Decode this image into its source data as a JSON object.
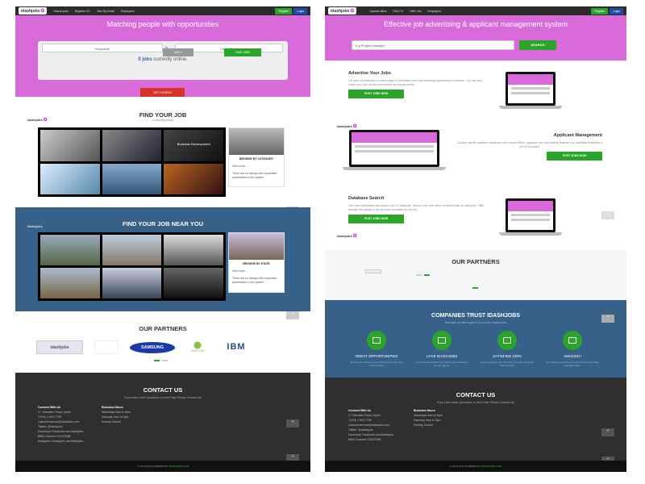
{
  "nav": {
    "logo": "idashjobs",
    "links_left": [
      "Search jobs",
      "Register CV",
      "Jobs By Email",
      "Employers"
    ],
    "links_right": [
      "Special offers",
      "Find CV",
      "Offer Job",
      "Employers"
    ],
    "register": "Register",
    "login": "Login"
  },
  "left": {
    "hero_title": "Matching people with opportunities",
    "keywords_placeholder": "Keywords",
    "in": "in",
    "city_placeholder": "City or State",
    "jobs_count": "0 jobs",
    "jobs_suffix": "currently online.",
    "any_button": "ANY ▾",
    "find_button": "FIND JOBS",
    "hired_button": "GET HIRED!",
    "find_job_title": "FIND YOUR JOB",
    "find_job_sub": "In trending areas",
    "tile_label": "Business Development",
    "browse_category": "BROWSE BY CATEGORY",
    "card_text_1": "View more...",
    "card_text_2": "There are no listings with requested parameters in the system.",
    "near_title": "FIND YOUR JOB NEAR YOU",
    "browse_state": "BROWSE BY STATE",
    "partners_title": "OUR PARTNERS",
    "partners": [
      "idashjobs",
      "Apple",
      "SAMSUNG",
      "ANDROID",
      "IBM"
    ],
    "contact_title": "CONTACT US",
    "contact_sub": "If you have some Questions or need Help! Please Contact Us!",
    "connect_title": "Connect With Us",
    "connect_lines": [
      "17, Salvation Road, Opebi",
      "+(234) 1 849 7759",
      "customerservice@idashjobs.com",
      "Twitter: @idashjobs",
      "Facebook: Facebook.com/idashjobs",
      "BBM Channel: C0047E6B",
      "Instagram: instagram.com/idashjobs"
    ],
    "hours_title": "Business Hours",
    "hours_lines": [
      "Weekdays 9am to 5pm",
      "Saturday 9am to 3pm",
      "Sunday Closed"
    ],
    "copyright": "© 2014-2016 POWERED BY",
    "copyright_brand": "IDASHJOBS.COM"
  },
  "right": {
    "hero_title": "Effective job advertising & applicant management system",
    "search_placeholder": "e.g Project manager",
    "search_button": "SEARCH",
    "advertise_title": "Advertise Your Jobs",
    "advertise_text": "Get your job adverts to a wide range of candidates and start receiving applications in minutes. You can also share your jobs across our network and social media.",
    "post_button": "POST JOBS NOW",
    "applicant_title": "Applicant Management",
    "applicant_text": "Quickly identify qualified candidates with search filters. Applicant sort and ranking features are available everytime a job ad is posted.",
    "database_title": "Database Search",
    "database_text": "Get more candidates and search our CV database. Search over one million professionals on idashjobs. Filter through the results to get the best candidate for the job.",
    "partners_title": "OUR PARTNERS",
    "trust_title": "COMPANIES TRUST IDASHJOBS",
    "trust_sub": "Because we offer support & customer satisfaction",
    "trust_items": [
      {
        "title": "GREAT OPPORTUNITIES",
        "text": "We help job seekers and employers find the right match quickly."
      },
      {
        "title": "LOVE IDASHJOBS",
        "text": "Loved by thousands of recruiters and candidates across Nigeria."
      },
      {
        "title": "SATISFIED 100%",
        "text": "Every employer gets full value on every single job advert posted."
      },
      {
        "title": "AMAZING!",
        "text": "An amazing experience for job seekers and hiring managers alike."
      }
    ],
    "contact_title": "CONTACT US",
    "contact_sub": "If you have some Questions or need Help! Please Contact Us!",
    "connect_title": "Connect With Us",
    "connect_lines": [
      "17 Salvation Road, Opebi",
      "+(234) 1 849 7759",
      "customerservice@idashjobs.com",
      "Twitter: @idashjobs",
      "Facebook: Facebook.com/idashjobs",
      "BBM Channel: C0047E6B"
    ],
    "hours_title": "Business Hours",
    "hours_lines": [
      "Weekdays 9am to 5pm",
      "Saturday 9am to 3pm",
      "Sunday Closed"
    ],
    "copyright": "© 2014-2016 POWERED BY",
    "copyright_brand": "IDASHJOBS.COM"
  },
  "colors": {
    "hero": "#d86ad9",
    "green": "#2aa52a",
    "blue": "#386189",
    "red": "#d8332a",
    "dark": "#2f2f2f"
  }
}
